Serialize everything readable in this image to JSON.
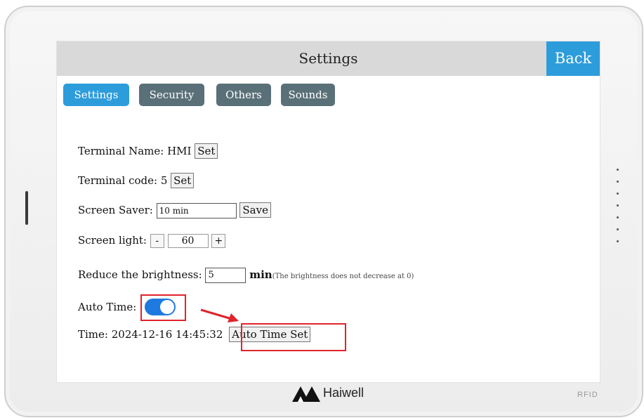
{
  "header": {
    "title": "Settings",
    "back_label": "Back"
  },
  "tabs": [
    {
      "label": "Settings",
      "active": true
    },
    {
      "label": "Security",
      "active": false
    },
    {
      "label": "Others",
      "active": false
    },
    {
      "label": "Sounds",
      "active": false
    }
  ],
  "terminal_name": {
    "label": "Terminal Name:",
    "value": "HMI",
    "button": "Set"
  },
  "terminal_code": {
    "label": "Terminal code:",
    "value": "5",
    "button": "Set"
  },
  "screen_saver": {
    "label": "Screen Saver:",
    "value": "10 min",
    "button": "Save"
  },
  "screen_light": {
    "label": "Screen light:",
    "minus": "-",
    "value": "60",
    "plus": "+"
  },
  "reduce_brightness": {
    "label": "Reduce the brightness:",
    "value": "5",
    "unit": "min",
    "note": "(The brightness does not decrease at 0)"
  },
  "auto_time": {
    "label": "Auto Time:",
    "enabled": true
  },
  "time": {
    "label": "Time:",
    "value": "2024-12-16 14:45:32",
    "button": "Auto Time Set"
  },
  "brand": {
    "name": "Haiwell",
    "rfid": "RFID"
  },
  "watermark": "Haiwell",
  "colors": {
    "accent": "#2d9cdb",
    "tab_inactive": "#5a7078",
    "highlight": "#e0242b",
    "toggle_on": "#1f7ae0"
  }
}
